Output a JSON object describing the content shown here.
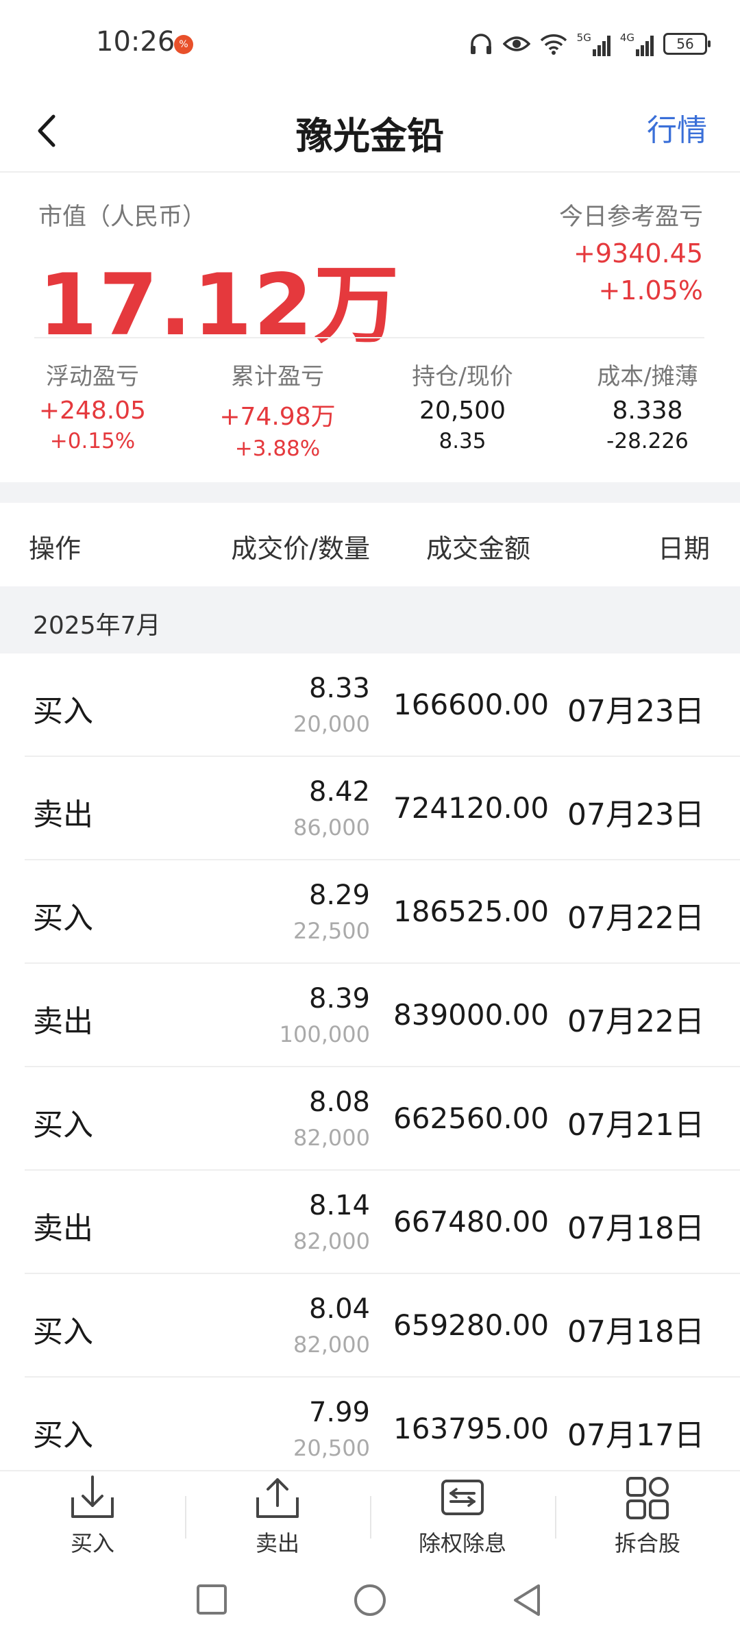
{
  "status_bar": {
    "time": "10:26",
    "notification_badge": "%",
    "battery": "56",
    "signal_1": "5G",
    "signal_2": "4G",
    "icons": [
      "headphones-icon",
      "eye-icon",
      "wifi-icon",
      "signal-5g-icon",
      "signal-4g-icon",
      "battery-icon"
    ]
  },
  "nav": {
    "title": "豫光金铅",
    "right_link": "行情"
  },
  "summary": {
    "market_value_label": "市值（人民币）",
    "market_value": "17.12万",
    "today_label": "今日参考盈亏",
    "today_amount": "+9340.45",
    "today_percent": "+1.05%",
    "stats": [
      {
        "label": "浮动盈亏",
        "value": "+248.05",
        "sub": "+0.15%"
      },
      {
        "label": "累计盈亏",
        "value": "+74.98万",
        "sub": "+3.88%"
      },
      {
        "label": "持仓/现价",
        "value": "20,500",
        "sub": "8.35"
      },
      {
        "label": "成本/摊薄",
        "value": "8.338",
        "sub": "-28.226"
      }
    ]
  },
  "table": {
    "headers": {
      "op": "操作",
      "price_qty": "成交价/数量",
      "amount": "成交金额",
      "date": "日期"
    },
    "month": "2025年7月",
    "rows": [
      {
        "op": "买入",
        "price": "8.33",
        "qty": "20,000",
        "amount": "166600.00",
        "date": "07月23日"
      },
      {
        "op": "卖出",
        "price": "8.42",
        "qty": "86,000",
        "amount": "724120.00",
        "date": "07月23日"
      },
      {
        "op": "买入",
        "price": "8.29",
        "qty": "22,500",
        "amount": "186525.00",
        "date": "07月22日"
      },
      {
        "op": "卖出",
        "price": "8.39",
        "qty": "100,000",
        "amount": "839000.00",
        "date": "07月22日"
      },
      {
        "op": "买入",
        "price": "8.08",
        "qty": "82,000",
        "amount": "662560.00",
        "date": "07月21日"
      },
      {
        "op": "卖出",
        "price": "8.14",
        "qty": "82,000",
        "amount": "667480.00",
        "date": "07月18日"
      },
      {
        "op": "买入",
        "price": "8.04",
        "qty": "82,000",
        "amount": "659280.00",
        "date": "07月18日"
      },
      {
        "op": "买入",
        "price": "7.99",
        "qty": "20,500",
        "amount": "163795.00",
        "date": "07月17日"
      }
    ]
  },
  "actions": [
    {
      "label": "买入",
      "icon": "buy-tray-icon"
    },
    {
      "label": "卖出",
      "icon": "sell-tray-icon"
    },
    {
      "label": "除权除息",
      "icon": "ex-dividend-icon"
    },
    {
      "label": "拆合股",
      "icon": "split-merge-grid-icon"
    }
  ],
  "colors": {
    "red": "#e5393d",
    "link_blue": "#3a6fd8",
    "band_gray": "#f2f3f5",
    "muted": "#777777"
  }
}
